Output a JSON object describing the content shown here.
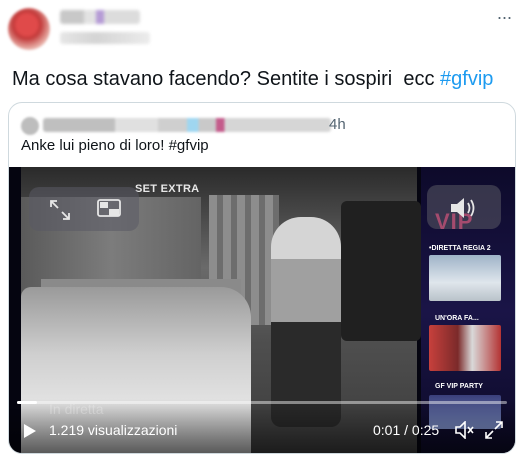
{
  "tweet": {
    "text": "Ma cosa stavano facendo? Sentite i sospiri  ecc ",
    "hashtag": "#gfvip"
  },
  "quoted": {
    "time": "4h",
    "text": "Anke lui pieno di loro! #gfvip"
  },
  "video": {
    "overlay_label": "SET EXTRA",
    "side_logo": "VIP",
    "thumb1_label": "•DIRETTA  REGIA 2",
    "thumb2_label": "UN'ORA FA...",
    "thumb3_label": "GF VIP PARTY",
    "ghost_text": "In diretta",
    "views": "1.219 visualizzazioni",
    "time": "0:01 / 0:25",
    "progress": 0.04
  },
  "icons": {
    "more": "more-icon",
    "expand": "expand-icon",
    "pip": "picture-in-picture-icon",
    "sound": "volume-icon",
    "play": "play-icon",
    "fullscreen": "fullscreen-icon"
  },
  "colors": {
    "hashtag": "#1d9bf0",
    "text": "#0f1419",
    "muted": "#536471",
    "border": "#cfd9de",
    "vip_accent": "#ff3a7a"
  }
}
